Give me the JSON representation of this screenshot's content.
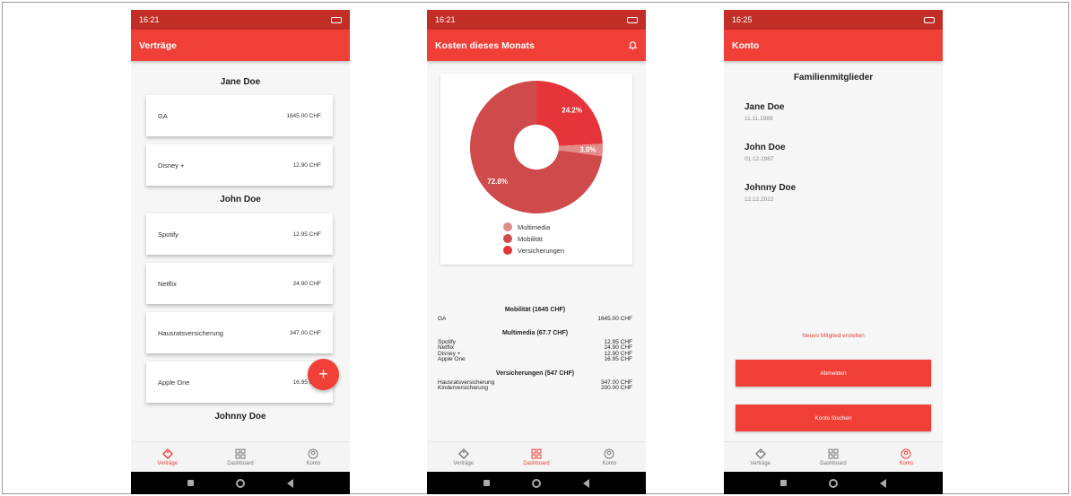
{
  "phone1": {
    "status_time": "16:21",
    "title": "Verträge",
    "groups": [
      {
        "name": "Jane Doe",
        "items": [
          {
            "name": "GA",
            "amount": "1645.00 CHF"
          },
          {
            "name": "Disney +",
            "amount": "12.90 CHF"
          }
        ]
      },
      {
        "name": "John Doe",
        "items": [
          {
            "name": "Spotify",
            "amount": "12.95 CHF"
          },
          {
            "name": "Netflix",
            "amount": "24.90 CHF"
          },
          {
            "name": "Hausratsversicherung",
            "amount": "347.00 CHF"
          },
          {
            "name": "Apple One",
            "amount": "16.95 CHF"
          }
        ]
      },
      {
        "name": "Johnny Doe",
        "items": []
      }
    ],
    "fab_label": "+"
  },
  "phone2": {
    "status_time": "16:21",
    "title": "Kosten dieses Monats",
    "chart_data": {
      "type": "pie",
      "categories": [
        "Multimedia",
        "Mobilität",
        "Versicherungen"
      ],
      "values": [
        3.0,
        72.8,
        24.2
      ],
      "labels": [
        "3.0%",
        "72.8%",
        "24.2%"
      ],
      "colors": [
        "#e28b88",
        "#cf4a4a",
        "#e5353a"
      ],
      "legend_position": "bottom"
    },
    "summary": [
      {
        "title": "Mobilität (1645 CHF)",
        "rows": [
          {
            "name": "GA",
            "amount": "1645.00 CHF"
          }
        ]
      },
      {
        "title": "Multimedia (67.7 CHF)",
        "rows": [
          {
            "name": "Spotify",
            "amount": "12.95 CHF"
          },
          {
            "name": "Netflix",
            "amount": "24.90 CHF"
          },
          {
            "name": "Disney +",
            "amount": "12.90 CHF"
          },
          {
            "name": "Apple One",
            "amount": "16.95 CHF"
          }
        ]
      },
      {
        "title": "Versicherungen (547 CHF)",
        "rows": [
          {
            "name": "Hausratsversicherung",
            "amount": "347.00 CHF"
          },
          {
            "name": "Kinderversicherung",
            "amount": "200.00 CHF"
          }
        ]
      }
    ]
  },
  "phone3": {
    "status_time": "16:25",
    "title": "Konto",
    "section_title": "Familienmitglieder",
    "members": [
      {
        "name": "Jane Doe",
        "date": "11.11.1989"
      },
      {
        "name": "John Doe",
        "date": "01.12.1987"
      },
      {
        "name": "Johnny Doe",
        "date": "12.12.2022"
      }
    ],
    "new_member_link": "Neues Mitglied erstellen",
    "logout_label": "Abmelden",
    "delete_label": "Konto löschen"
  },
  "nav": {
    "contracts": "Verträge",
    "dashboard": "Dashboard",
    "account": "Konto"
  },
  "colors": {
    "primary": "#ef3f37",
    "statusbar": "#c22d26"
  }
}
